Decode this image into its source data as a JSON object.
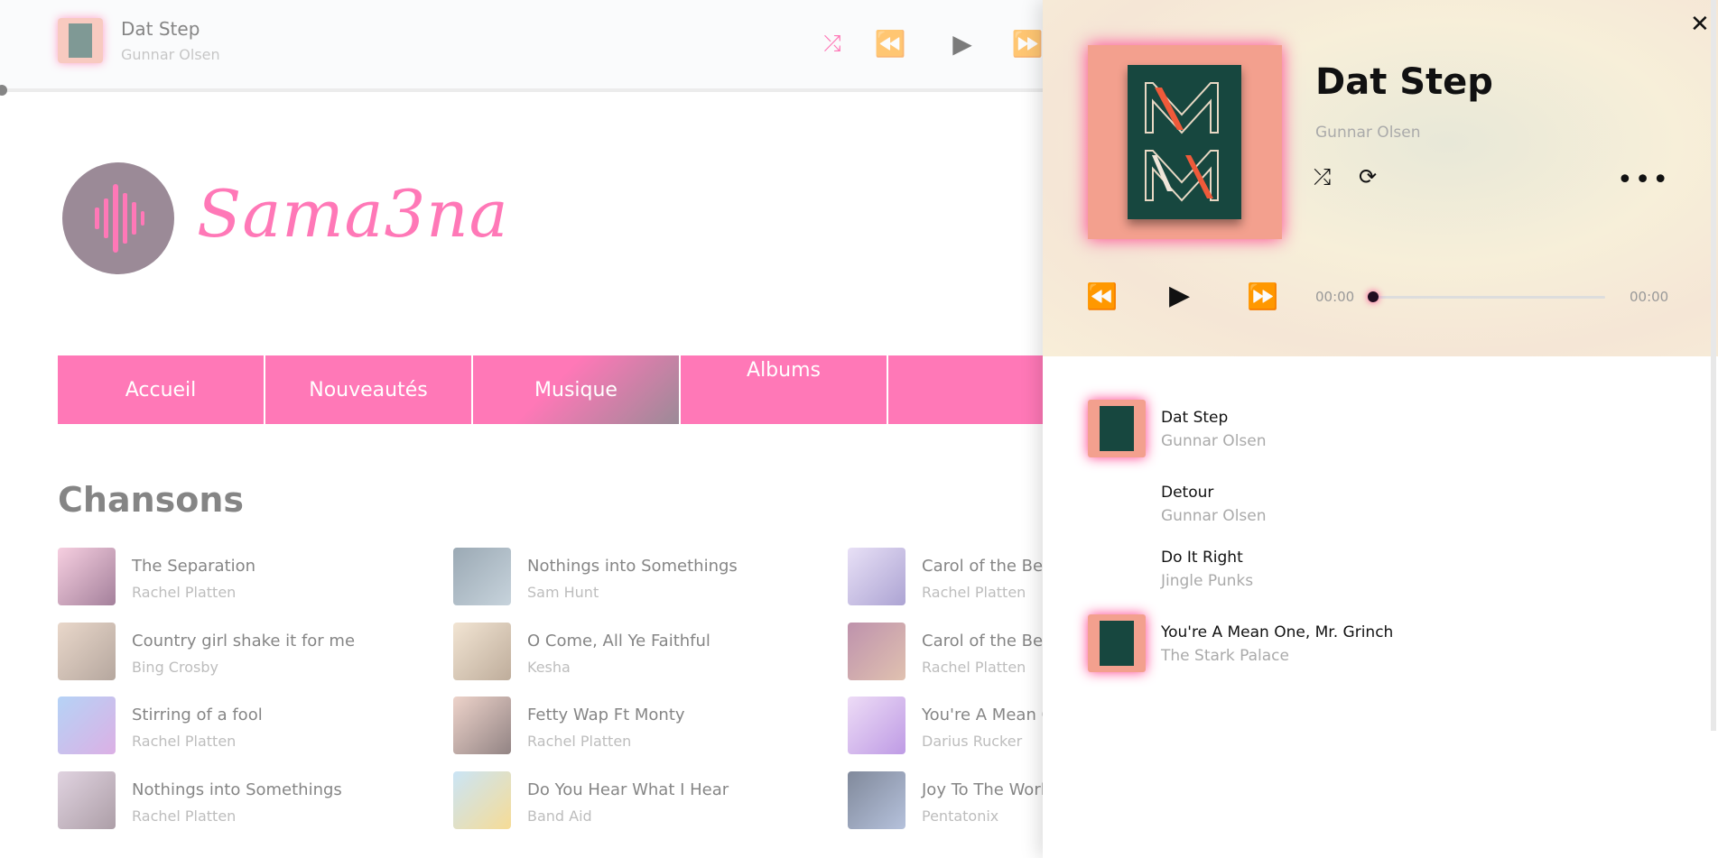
{
  "top_player": {
    "title": "Dat Step",
    "artist": "Gunnar Olsen"
  },
  "logo": {
    "text": "Sama3na"
  },
  "nav": {
    "items": [
      "Accueil",
      "Nouveautés",
      "Musique",
      "Albums",
      ""
    ],
    "active": "Musique"
  },
  "section": {
    "title": "Chansons"
  },
  "songs": [
    {
      "title": "The Separation",
      "artist": "Rachel Platten"
    },
    {
      "title": "Nothings into Somethings",
      "artist": "Sam Hunt"
    },
    {
      "title": "Carol of the Bell",
      "artist": "Rachel Platten"
    },
    {
      "title": "Country girl shake it for me",
      "artist": "Bing Crosby"
    },
    {
      "title": "O Come, All Ye Faithful",
      "artist": "Kesha"
    },
    {
      "title": "Carol of the Bell",
      "artist": "Rachel Platten"
    },
    {
      "title": "Stirring of a fool",
      "artist": "Rachel Platten"
    },
    {
      "title": "Fetty Wap Ft Monty",
      "artist": "Rachel Platten"
    },
    {
      "title": "You're A Mean C",
      "artist": "Darius Rucker"
    },
    {
      "title": "Nothings into Somethings",
      "artist": "Rachel Platten"
    },
    {
      "title": "Do You Hear What I Hear",
      "artist": "Band Aid"
    },
    {
      "title": "Joy To The Worl",
      "artist": "Pentatonix"
    }
  ],
  "panel": {
    "title": "Dat Step",
    "artist": "Gunnar Olsen",
    "time_current": "00:00",
    "time_total": "00:00",
    "progress": 0,
    "queue": [
      {
        "title": "Dat Step",
        "artist": "Gunnar Olsen",
        "has_thumb": true
      },
      {
        "title": "Detour",
        "artist": "Gunnar Olsen",
        "has_thumb": false
      },
      {
        "title": "Do It Right",
        "artist": "Jingle Punks",
        "has_thumb": false
      },
      {
        "title": "You're A Mean One, Mr. Grinch",
        "artist": "The Stark Palace",
        "has_thumb": true
      }
    ]
  },
  "colors": {
    "accent": "#ff0a7d",
    "dark": "#4a2c43"
  }
}
